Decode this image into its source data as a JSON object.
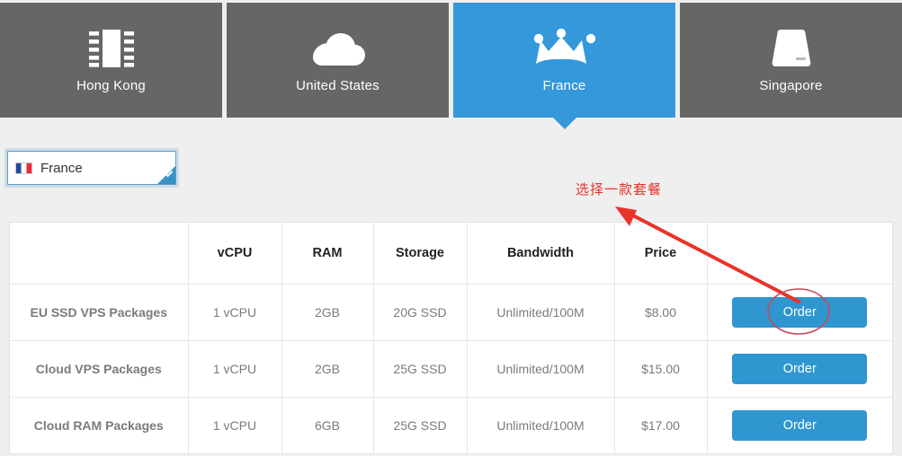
{
  "colors": {
    "tile_default_bg": "#666666",
    "tile_selected_bg": "#3498db",
    "page_bg": "#efefef",
    "order_button_bg": "#2f96d0",
    "annotation_red": "#e8332a",
    "select_border": "#5a9ec7"
  },
  "locations": {
    "tiles": [
      {
        "label": "Hong Kong",
        "icon": "cpu-chip-icon",
        "selected": false
      },
      {
        "label": "United States",
        "icon": "cloud-icon",
        "selected": false
      },
      {
        "label": "France",
        "icon": "crown-icon",
        "selected": true
      },
      {
        "label": "Singapore",
        "icon": "server-icon",
        "selected": false
      }
    ]
  },
  "country_select": {
    "value": "France",
    "flag_icon": "france-flag-icon",
    "corner_icon": "check-corner-icon"
  },
  "annotation": {
    "text": "选择一款套餐",
    "arrow_icon": "red-arrow-icon",
    "circle_icon": "red-ellipse-highlight-icon"
  },
  "packages_table": {
    "headers": [
      "",
      "vCPU",
      "RAM",
      "Storage",
      "Bandwidth",
      "Price",
      ""
    ],
    "rows": [
      {
        "name": "EU SSD VPS Packages",
        "vcpu": "1 vCPU",
        "ram": "2GB",
        "storage": "20G SSD",
        "bandwidth": "Unlimited/100M",
        "price": "$8.00",
        "action": "Order"
      },
      {
        "name": "Cloud VPS Packages",
        "vcpu": "1 vCPU",
        "ram": "2GB",
        "storage": "25G SSD",
        "bandwidth": "Unlimited/100M",
        "price": "$15.00",
        "action": "Order"
      },
      {
        "name": "Cloud RAM Packages",
        "vcpu": "1 vCPU",
        "ram": "6GB",
        "storage": "25G SSD",
        "bandwidth": "Unlimited/100M",
        "price": "$17.00",
        "action": "Order"
      }
    ]
  }
}
